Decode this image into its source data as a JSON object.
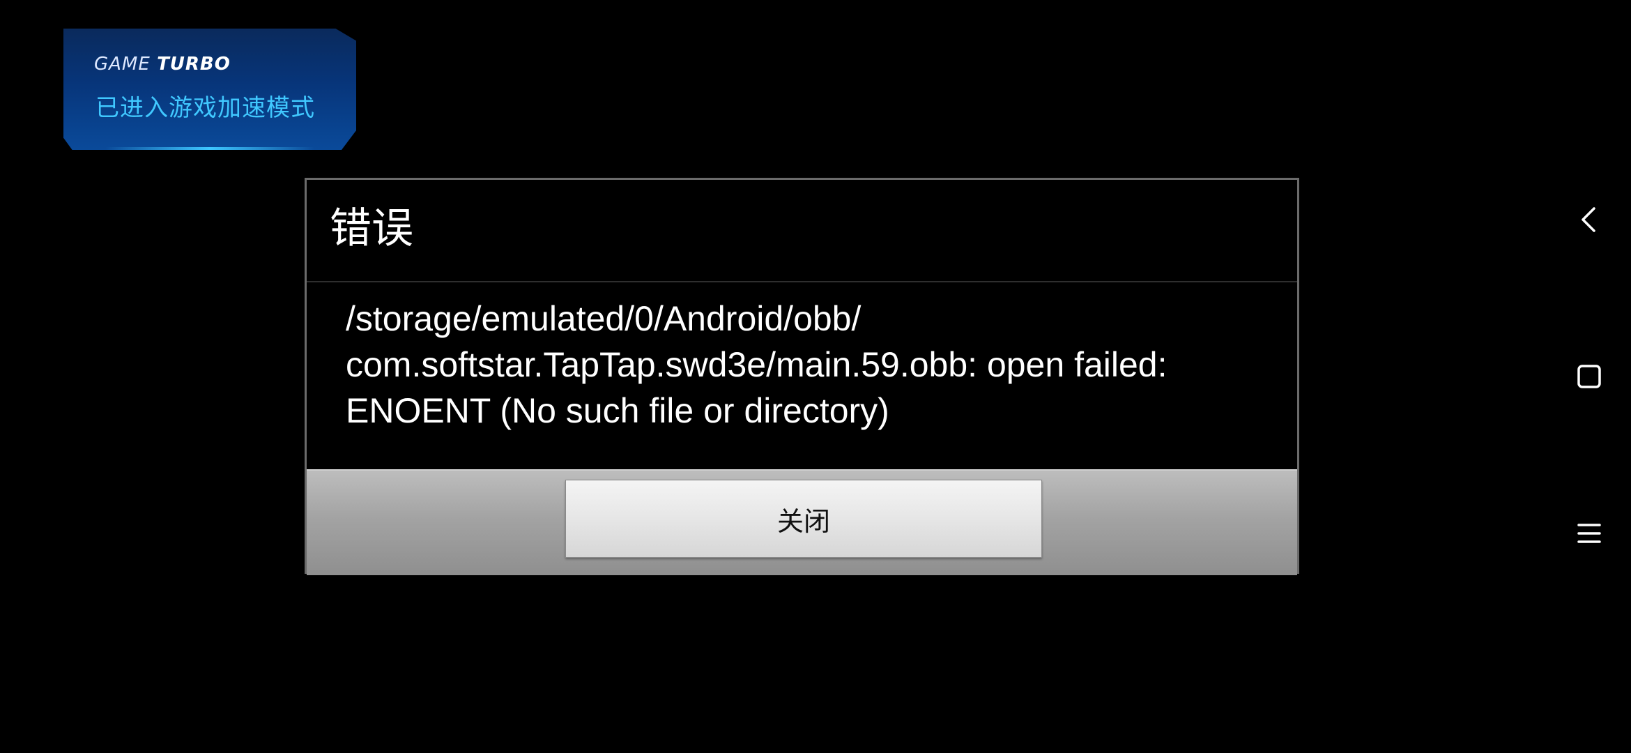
{
  "overlay": {
    "brand_game": "GAME",
    "brand_turbo": "TURBO",
    "status": "已进入游戏加速模式"
  },
  "background_dialog": {
    "title": "错误"
  },
  "dialog": {
    "title": "错误",
    "message": "/storage/emulated/0/Android/obb/\ncom.softstar.TapTap.swd3e/main.59.obb: open failed:\nENOENT (No such file or directory)",
    "close_label": "关闭"
  },
  "nav": {
    "back_icon": "back-chevron-icon",
    "home_icon": "home-square-icon",
    "menu_icon": "menu-lines-icon"
  },
  "colors": {
    "turbo_status": "#40c8ff",
    "dialog_border": "#6b6b6b",
    "button_bar": "#a3a3a3"
  }
}
